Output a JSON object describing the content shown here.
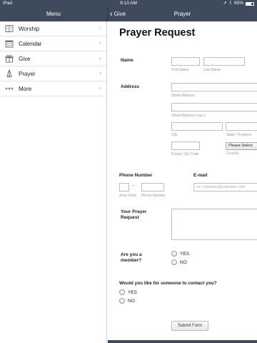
{
  "status": {
    "carrier": "iPad",
    "time": "9:13 AM",
    "battery": "65%",
    "battery_level": 0.65
  },
  "nav": {
    "left_title": "Menu",
    "back_label": "Give",
    "right_title": "Prayer"
  },
  "sidebar": {
    "items": [
      {
        "label": "Worship",
        "icon": "book-icon"
      },
      {
        "label": "Calendar",
        "icon": "calendar-icon"
      },
      {
        "label": "Give",
        "icon": "gift-icon"
      },
      {
        "label": "Prayer",
        "icon": "praying-hands-icon"
      },
      {
        "label": "More",
        "icon": "ellipsis-icon"
      }
    ]
  },
  "form": {
    "title": "Prayer Request",
    "name_label": "Name",
    "first_name_sub": "First Name",
    "last_name_sub": "Last Name",
    "address_label": "Address",
    "street_sub": "Street Address",
    "street2_sub": "Street Address Line 2",
    "city_sub": "City",
    "state_sub": "State / Province",
    "zip_sub": "Postal / Zip Code",
    "country_select": "Please Select",
    "country_sub": "Country",
    "phone_label": "Phone Number",
    "phone_dash": "-",
    "area_code_sub": "Area Code",
    "phone_sub": "Phone Number",
    "email_label": "E-mail",
    "email_placeholder": "ex: myname@example.com",
    "prayer_label_line1": "Your Prayer",
    "prayer_label_line2": "Request",
    "member_label_line1": "Are you a",
    "member_label_line2": "member?",
    "member_yes": "YES",
    "member_no": "NO",
    "contact_question": "Would you like for someone to contact you?",
    "contact_yes": "YES",
    "contact_no": "NO",
    "submit_label": "Submit Form"
  }
}
